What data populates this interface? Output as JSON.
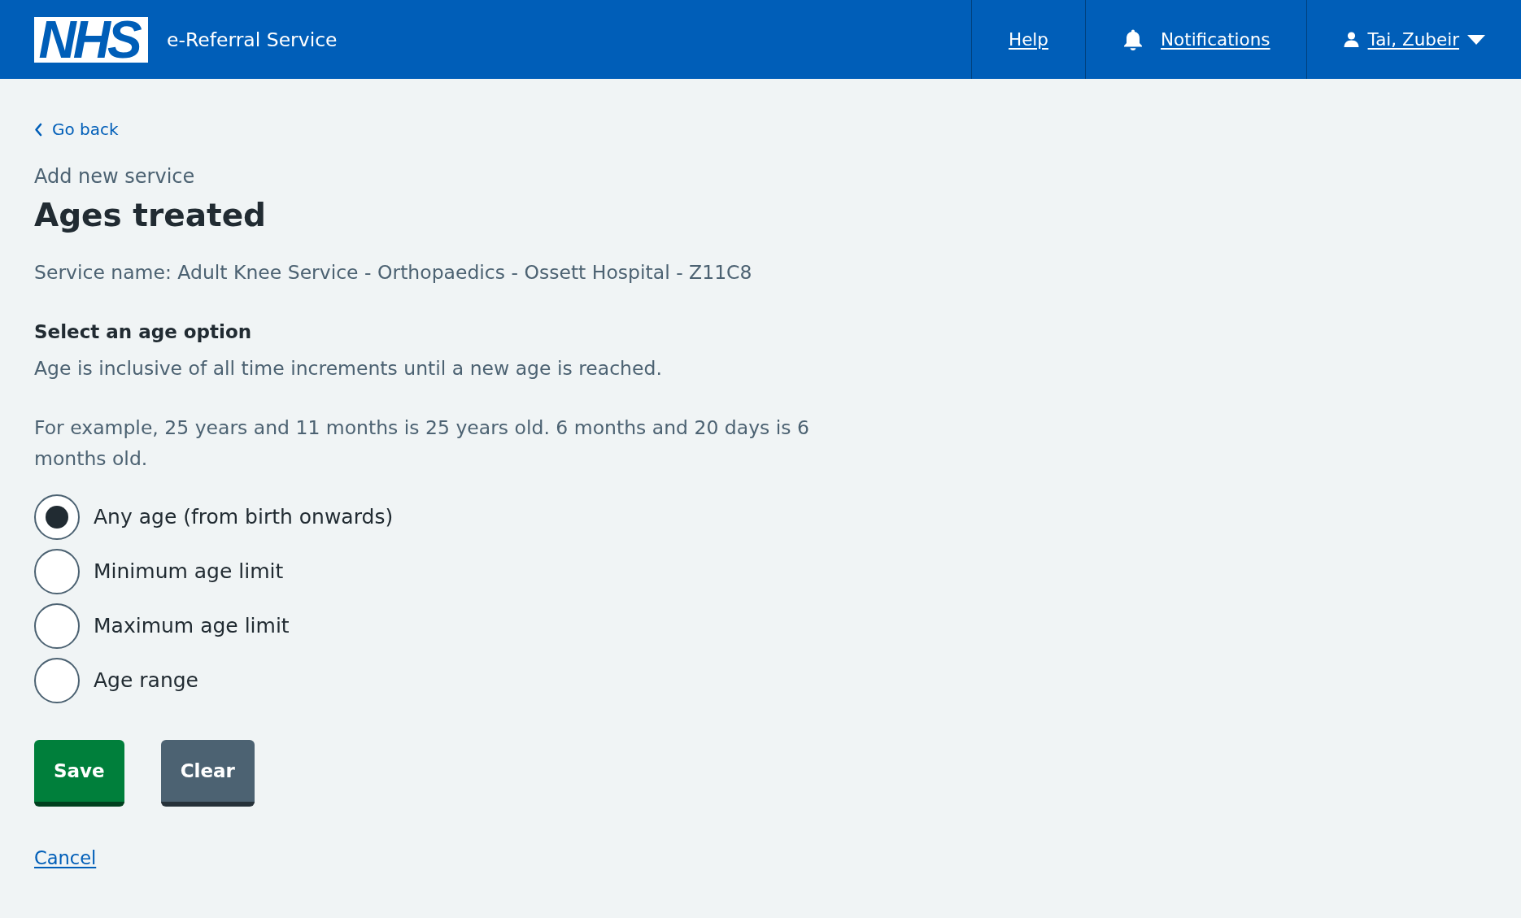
{
  "header": {
    "logo": "NHS",
    "service_name": "e-Referral Service",
    "nav": [
      {
        "kind": "link",
        "label": "Help"
      },
      {
        "kind": "notifications",
        "label": "Notifications"
      },
      {
        "kind": "account",
        "label": "Tai, Zubeir"
      }
    ]
  },
  "back_link": {
    "label": "Go back"
  },
  "caption": "Add new service",
  "heading": "Ages treated",
  "service_name": "Service name: Adult Knee Service - Orthopaedics - Ossett Hospital - Z11C8",
  "question": {
    "legend": "Select an age option",
    "hints": [
      "Age is inclusive of all time increments until a new age is reached.",
      "For example, 25 years and 11 months is 25 years old. 6 months and 20 days is 6 months old."
    ],
    "options": [
      {
        "label": "Any age (from birth onwards)",
        "selected": true
      },
      {
        "label": "Minimum age limit",
        "selected": false
      },
      {
        "label": "Maximum age limit",
        "selected": false
      },
      {
        "label": "Age range",
        "selected": false
      }
    ]
  },
  "buttons": [
    {
      "kind": "primary",
      "label": "Save"
    },
    {
      "kind": "secondary",
      "label": "Clear"
    }
  ],
  "cancel_link": {
    "label": "Cancel"
  }
}
